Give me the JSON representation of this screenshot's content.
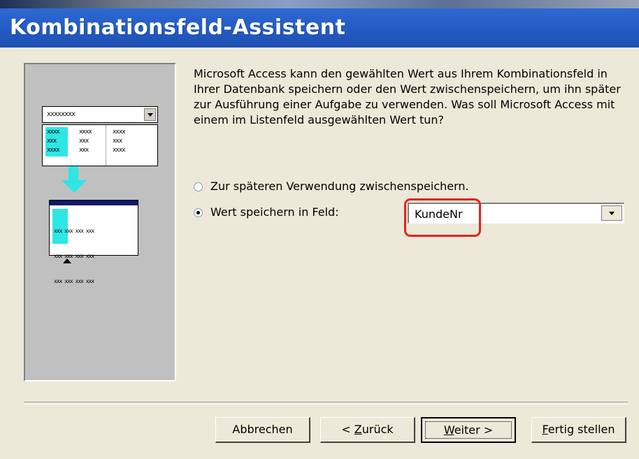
{
  "window": {
    "title": "Kombinationsfeld-Assistent"
  },
  "illustration": {
    "combo_text": "xxxxxxxx",
    "list_col1": [
      "xxxx",
      "xxx",
      "xxxx"
    ],
    "list_col2": [
      "xxxx",
      "xxx",
      "xxx"
    ],
    "list_col3": [
      "xxxx",
      "xxx",
      "xxxx"
    ],
    "table_rows": [
      "xxx xxx xxx xxx",
      "xxx xxx xxx xxx",
      "xxx xxx xxx xxx"
    ]
  },
  "description": "Microsoft Access kann den gewählten Wert aus Ihrem Kombinationsfeld in Ihrer Datenbank speichern oder den Wert zwischenspeichern, um ihn später zur Ausführung einer Aufgabe zu verwenden. Was soll Microsoft Access mit einem im Listenfeld ausgewählten Wert tun?",
  "options": {
    "remember_label": "Zur späteren Verwendung zwischenspeichern.",
    "store_label": "Wert speichern in Feld:",
    "selected": "store"
  },
  "field": {
    "value": "KundeNr"
  },
  "buttons": {
    "cancel": "Abbrechen",
    "back_prefix": "< ",
    "back_mnemonic": "Z",
    "back_rest": "urück",
    "next_mnemonic": "W",
    "next_rest": "eiter >",
    "finish_mnemonic": "F",
    "finish_rest": "ertig stellen"
  },
  "colors": {
    "titlebar": "#2a63cc",
    "highlight": "#e4231f",
    "illustration_accent": "#2ee6e6"
  }
}
